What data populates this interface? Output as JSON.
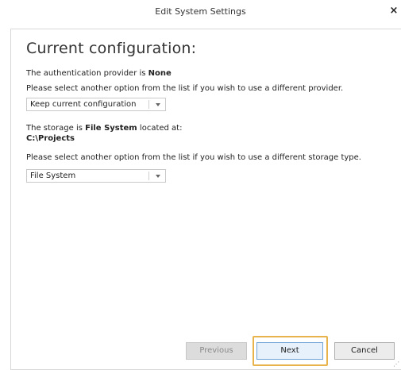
{
  "window": {
    "title": "Edit System Settings",
    "close_glyph": "×"
  },
  "main": {
    "heading": "Current configuration:",
    "auth": {
      "prefix": "The authentication provider is",
      "value": "None",
      "instruction": "Please select another option from the list if you wish to use a different provider.",
      "dropdown_value": "Keep current configuration"
    },
    "storage": {
      "prefix": "The storage is",
      "type": "File System",
      "suffix": "located at:",
      "path": "C:\\Projects",
      "instruction": "Please select another option from the list if you wish to use a different storage type.",
      "dropdown_value": "File System"
    }
  },
  "footer": {
    "previous_label": "Previous",
    "next_label": "Next",
    "cancel_label": "Cancel"
  },
  "icons": {
    "close": "close-icon",
    "dropdown_arrow": "chevron-down-icon",
    "resize_grip": "resize-grip-icon"
  },
  "colors": {
    "focus_ring": "#e8b34a",
    "next_button_bg": "#e7f1fb",
    "previous_button_bg": "#dcdcdc"
  }
}
